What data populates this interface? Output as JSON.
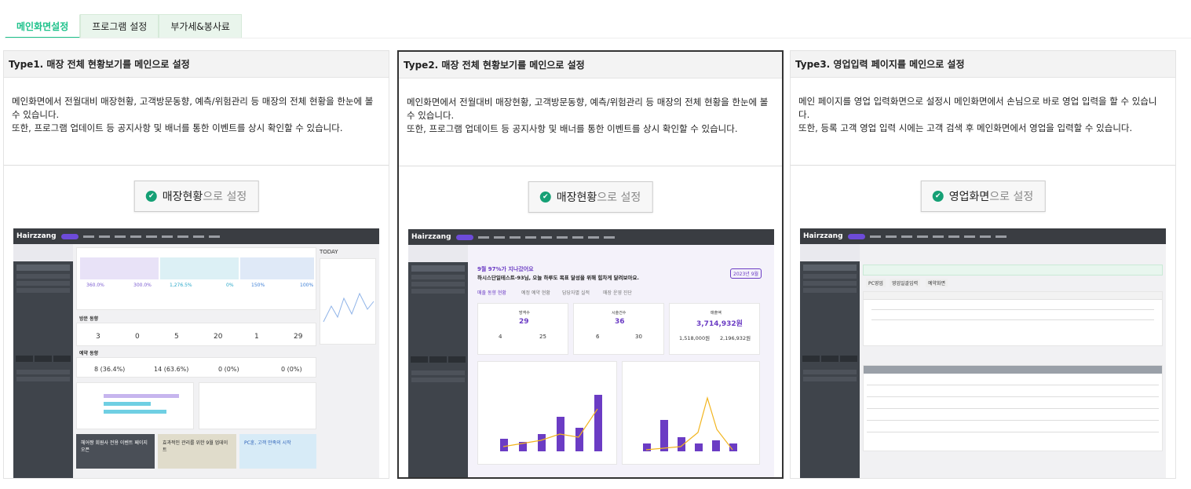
{
  "tabs": [
    {
      "label": "메인화면설정",
      "active": true
    },
    {
      "label": "프로그램 설정",
      "active": false
    },
    {
      "label": "부가세&봉사료",
      "active": false
    }
  ],
  "cards": [
    {
      "title": "Type1. 매장 전체 현황보기를 메인으로 설정",
      "desc1": "메인화면에서 전월대비 매장현황, 고객방문동향, 예측/위험관리 등 매장의 전체 현황을 한눈에 볼 수 있습니다.",
      "desc2": "또한, 프로그램 업데이트 등 공지사항 및 배너를 통한 이벤트를 상시 확인할 수 있습니다.",
      "btn_main": "매장현황",
      "btn_suffix": "으로 설정",
      "selected": false
    },
    {
      "title": "Type2. 매장 전체 현황보기를 메인으로 설정",
      "desc1": "메인화면에서 전월대비 매장현황, 고객방문동향, 예측/위험관리 등 매장의 전체 현황을 한눈에 볼 수 있습니다.",
      "desc2": "또한, 프로그램 업데이트 등 공지사항 및 배너를 통한 이벤트를 상시 확인할 수 있습니다.",
      "btn_main": "매장현황",
      "btn_suffix": "으로 설정",
      "selected": true
    },
    {
      "title": "Type3. 영업입력 페이지를 메인으로 설정",
      "desc1": "메인 페이지를 영업 입력화면으로 설정시 메인화면에서 손님으로 바로 영업 입력을 할 수 있습니다.",
      "desc2": "또한, 등록 고객 영업 입력 시에는 고객 검색 후 메인화면에서 영업을 입력할 수 있습니다.",
      "btn_main": "영업화면",
      "btn_suffix": "으로 설정",
      "selected": false
    }
  ],
  "preview": {
    "logo": "Hairzzang",
    "t1_stats": [
      "360.0%",
      "300.0%",
      "1,276.5%",
      "0%",
      "150%",
      "100%"
    ],
    "t1_counts": [
      "3",
      "0",
      "5",
      "20",
      "1",
      "29"
    ],
    "t1_pct": [
      "8 (36.4%)",
      "14 (63.6%)",
      "0 (0%)",
      "0 (0%)"
    ],
    "t1_section_today": "TODAY",
    "t1_section_visit": "방문 동향",
    "t1_section_forecast": "예약 동향",
    "t1_banner1": "헤어짱 회원사 전용 이벤트 페이지 오픈",
    "t1_banner2": "효과적인 관리를 위한 9월 업데이트",
    "t1_banner3": "PC훈, 고객 만족의 시작",
    "t2_headline1": "9월 97%가 지나갔어요",
    "t2_headline2": "하시스단일테스트-93님, 오늘 하루도 목표 달성을 위해 힘차게 달려보아요.",
    "t2_tabs": [
      "매출 동향 현황",
      "예정 예약 현황",
      "담당자별 실적",
      "매장 운영 진단"
    ],
    "t2_kpi": [
      {
        "label": "방객수",
        "value": "29"
      },
      {
        "label": "시술건수",
        "value": "36"
      },
      {
        "label": "매출액",
        "value": "3,714,932원"
      }
    ],
    "t2_sub": [
      "4",
      "25",
      "6",
      "30",
      "1,518,000원",
      "2,196,932원"
    ],
    "t2_month": "2023년 9월",
    "t3_buttons": [
      "PC영업",
      "영업일괄입력",
      "예약화면"
    ]
  },
  "colors": {
    "accent": "#1ec28b",
    "purple": "#6b3cc4",
    "dark": "#3a3d42",
    "check": "#15a075"
  }
}
